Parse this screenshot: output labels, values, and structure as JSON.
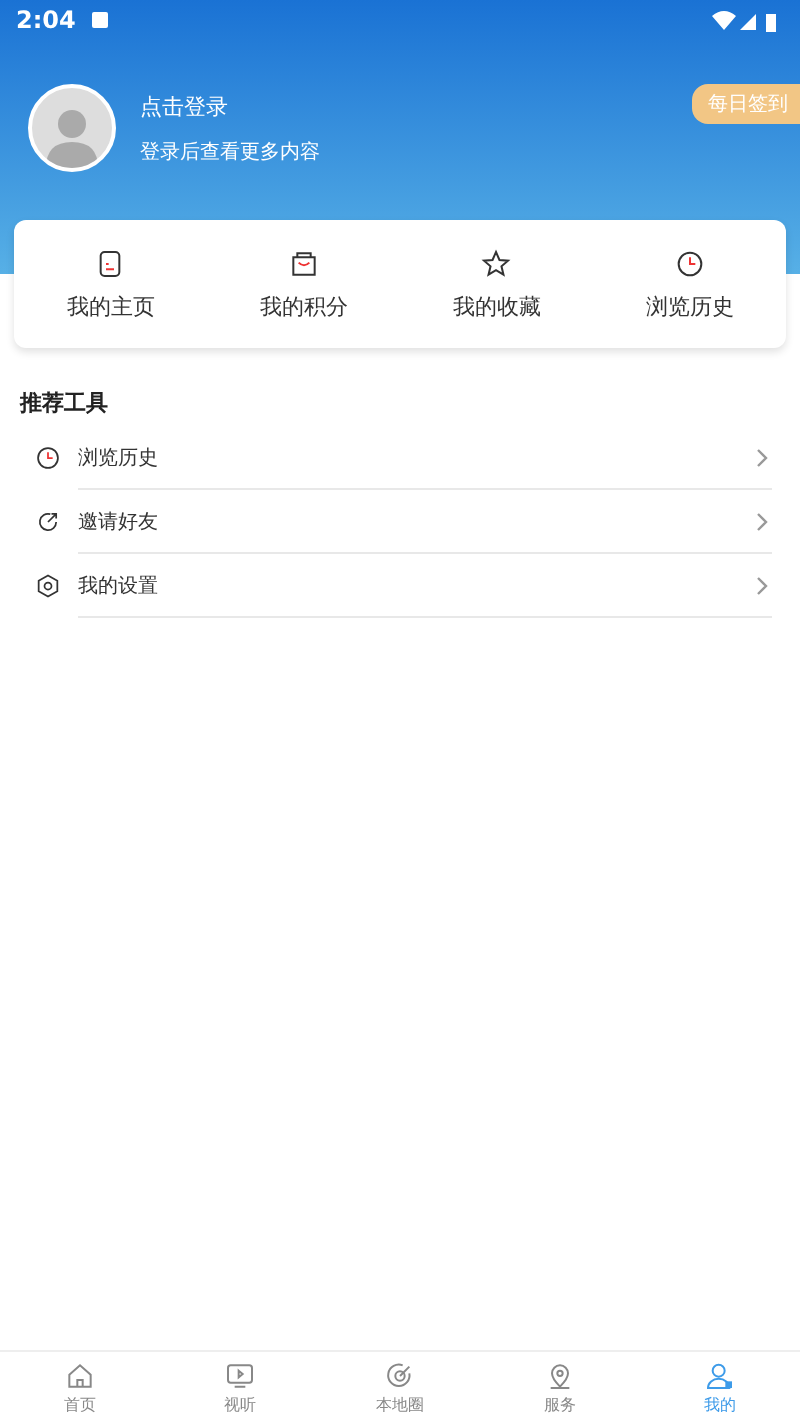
{
  "status_bar": {
    "time": "2:04"
  },
  "profile": {
    "title": "点击登录",
    "subtitle": "登录后查看更多内容",
    "checkin": "每日签到"
  },
  "shortcuts": [
    {
      "kind": "page",
      "label": "我的主页"
    },
    {
      "kind": "bag",
      "label": "我的积分"
    },
    {
      "kind": "star",
      "label": "我的收藏"
    },
    {
      "kind": "clock",
      "label": "浏览历史"
    }
  ],
  "tools": {
    "title": "推荐工具",
    "items": [
      {
        "kind": "clock",
        "label": "浏览历史"
      },
      {
        "kind": "share",
        "label": "邀请好友"
      },
      {
        "kind": "settings",
        "label": "我的设置"
      }
    ]
  },
  "tab_bar": [
    {
      "kind": "home",
      "label": "首页",
      "selected": false
    },
    {
      "kind": "tv",
      "label": "视听",
      "selected": false
    },
    {
      "kind": "target",
      "label": "本地圈",
      "selected": false
    },
    {
      "kind": "pin",
      "label": "服务",
      "selected": false
    },
    {
      "kind": "user",
      "label": "我的",
      "selected": true
    }
  ]
}
